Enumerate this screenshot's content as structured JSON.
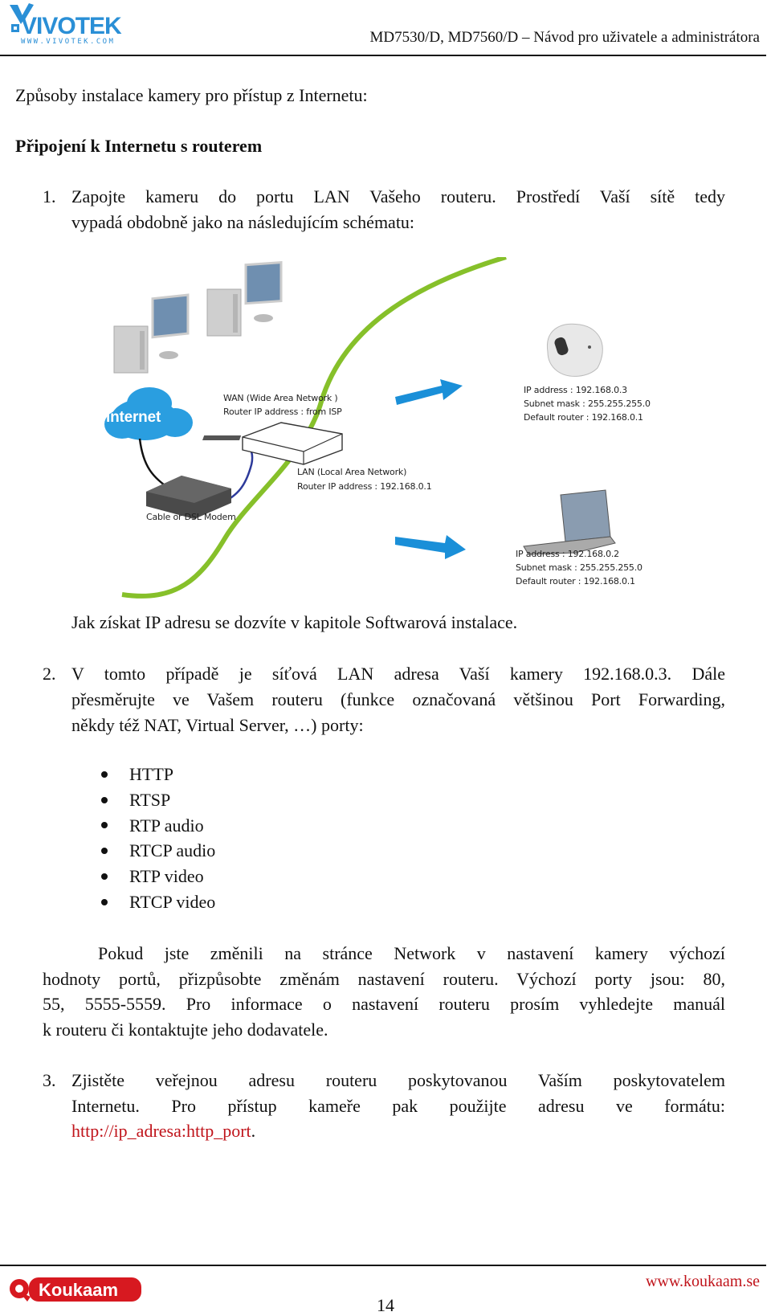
{
  "header": {
    "logo_text": "VIVOTEK",
    "logo_url": "WWW.VIVOTEK.COM",
    "title": "MD7530/D, MD7560/D – Návod pro uživatele a administrátora"
  },
  "intro": "Způsoby instalace kamery pro přístup z Internetu:",
  "section_title": "Připojení k Internetu s routerem",
  "step1": {
    "number": "1.",
    "line1": "Zapojte kameru do portu LAN Vašeho routeru. Prostředí Vaší sítě tedy",
    "line2": "vypadá obdobně jako na následujícím schématu:"
  },
  "diagram": {
    "internet_label": "Internet",
    "modem_label": "Cable or DSL Modem",
    "wan_line1": "WAN (Wide Area Network )",
    "wan_line2": "Router IP address : from ISP",
    "lan_line1": "LAN (Local Area Network)",
    "lan_line2": "Router IP address : 192.168.0.1",
    "camera": {
      "ip": "IP address : 192.168.0.3",
      "mask": "Subnet mask : 255.255.255.0",
      "router": "Default router : 192.168.0.1"
    },
    "laptop": {
      "ip": "IP address : 192.168.0.2",
      "mask": "Subnet mask : 255.255.255.0",
      "router": "Default router : 192.168.0.1"
    },
    "colors": {
      "lan_boundary": "#86c02a",
      "arrow": "#1a8fd8",
      "cloud": "#2a9ee0",
      "cable": "#2d3a9a"
    }
  },
  "ip_note": "Jak získat IP adresu se dozvíte v kapitole Softwarová instalace.",
  "step2": {
    "number": "2.",
    "line1": "V tomto případě je síťová LAN adresa Vaší kamery 192.168.0.3. Dále",
    "line2": "přesměrujte ve Vašem routeru (funkce označovaná většinou Port Forwarding,",
    "line3": "někdy též NAT, Virtual Server, …) porty:"
  },
  "ports": [
    "HTTP",
    "RTSP",
    "RTP audio",
    "RTCP audio",
    "RTP video",
    "RTCP video"
  ],
  "ports_note": {
    "line1": "Pokud jste změnili na stránce Network v nastavení kamery výchozí",
    "line2": "hodnoty portů, přizpůsobte změnám nastavení routeru. Výchozí porty jsou: 80,",
    "line3": "55, 5555-5559. Pro informace o nastavení routeru prosím vyhledejte manuál",
    "line4": "k routeru či kontaktujte jeho dodavatele."
  },
  "step3": {
    "number": "3.",
    "line1": "Zjistěte veřejnou adresu routeru poskytovanou Vaším poskytovatelem",
    "line2": "Internetu. Pro přístup kameře pak použijte adresu ve formátu:",
    "link": "http://ip_adresa:http_port",
    "link_suffix": "."
  },
  "footer": {
    "logo_text": "Koukaam",
    "url": "www.koukaam.se",
    "page": "14"
  }
}
